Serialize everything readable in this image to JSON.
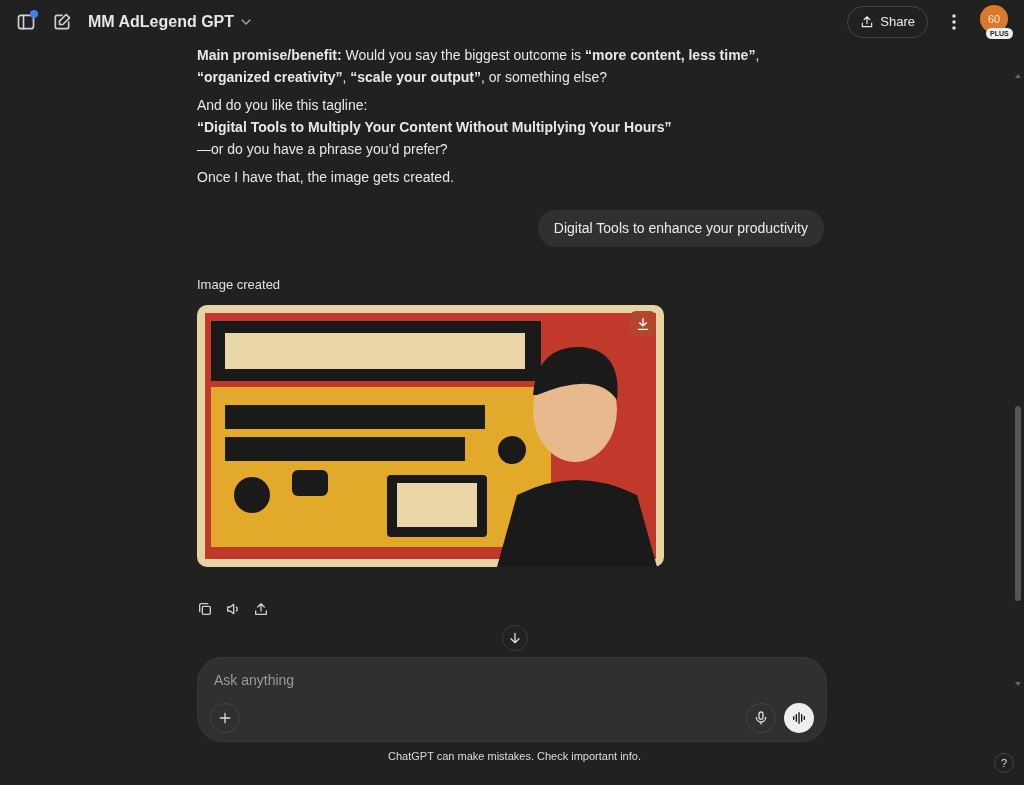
{
  "header": {
    "title": "MM AdLegend GPT",
    "share": "Share",
    "avatar": {
      "initials": "60",
      "badge": "PLUS"
    }
  },
  "messages": [
    {
      "kind": "assistant_text",
      "paragraphs": [
        [
          "**Main promise/benefit:** Would you say the biggest outcome is **“more content, less time”**, **“organized creativity”**, **“scale your output”**, or something else?"
        ],
        [
          "And do you like this tagline:",
          "**“Digital Tools to Multiply Your Content Without Multiplying Your Hours”**",
          "—or do you have a phrase you’d prefer?"
        ],
        [
          "Once I have that, the image gets created."
        ]
      ]
    },
    {
      "kind": "user",
      "text": "Digital Tools to enhance your productivity"
    },
    {
      "kind": "assistant_image",
      "caption": "Image created"
    }
  ],
  "composer": {
    "placeholder": "Ask anything"
  },
  "disclaimer": "ChatGPT can make mistakes. Check important info.",
  "help": "?"
}
